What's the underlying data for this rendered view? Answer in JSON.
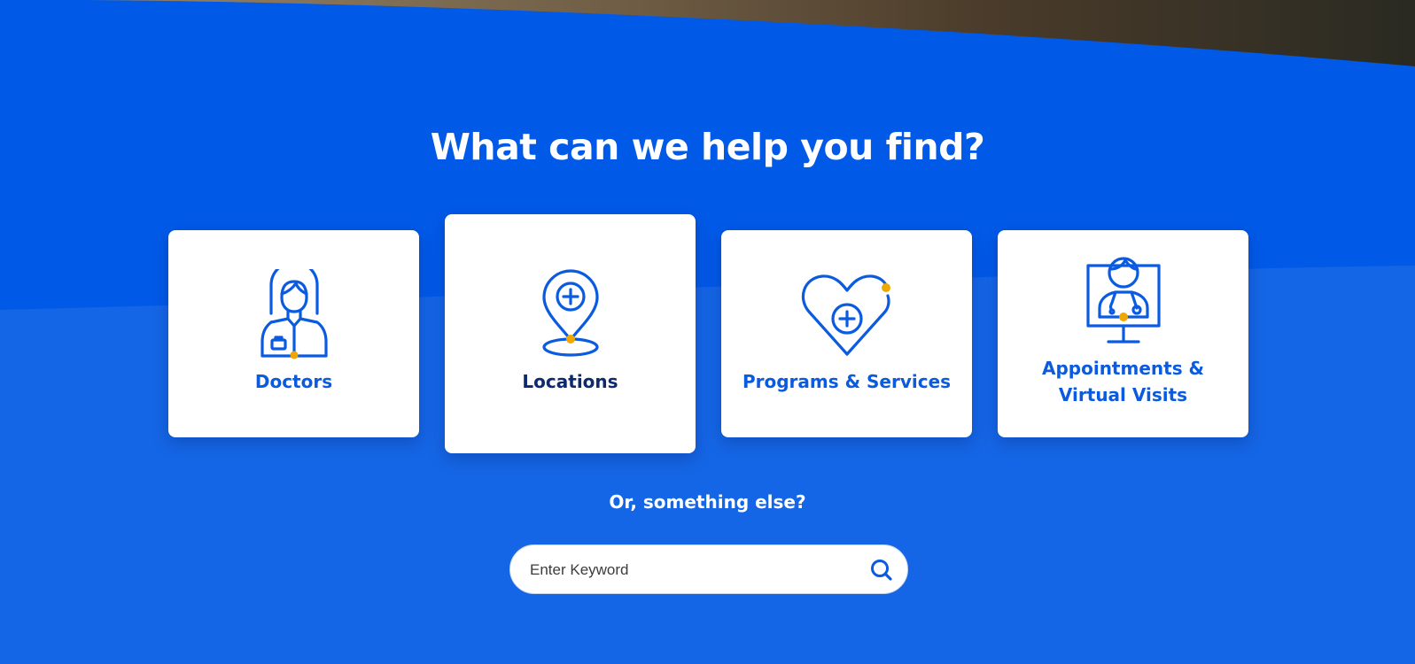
{
  "colors": {
    "band_primary": "#005ae8",
    "band_secondary": "#1566e6",
    "card_label": "#0a5be0",
    "card_label_active": "#0b2a6f",
    "icon_stroke": "#0a5be0",
    "icon_accent": "#f0a800",
    "heading_text": "#ffffff"
  },
  "section": {
    "title": "What can we help you find?",
    "subtitle": "Or, something else?"
  },
  "cards": [
    {
      "label": "Doctors",
      "icon": "doctor-icon",
      "active": false
    },
    {
      "label": "Locations",
      "icon": "location-pin-icon",
      "active": true
    },
    {
      "label": "Programs & Services",
      "icon": "heart-plus-icon",
      "active": false
    },
    {
      "label": "Appointments & Virtual Visits",
      "icon": "virtual-visit-icon",
      "active": false
    }
  ],
  "search": {
    "placeholder": "Enter Keyword",
    "value": "",
    "button_icon": "search-icon"
  }
}
